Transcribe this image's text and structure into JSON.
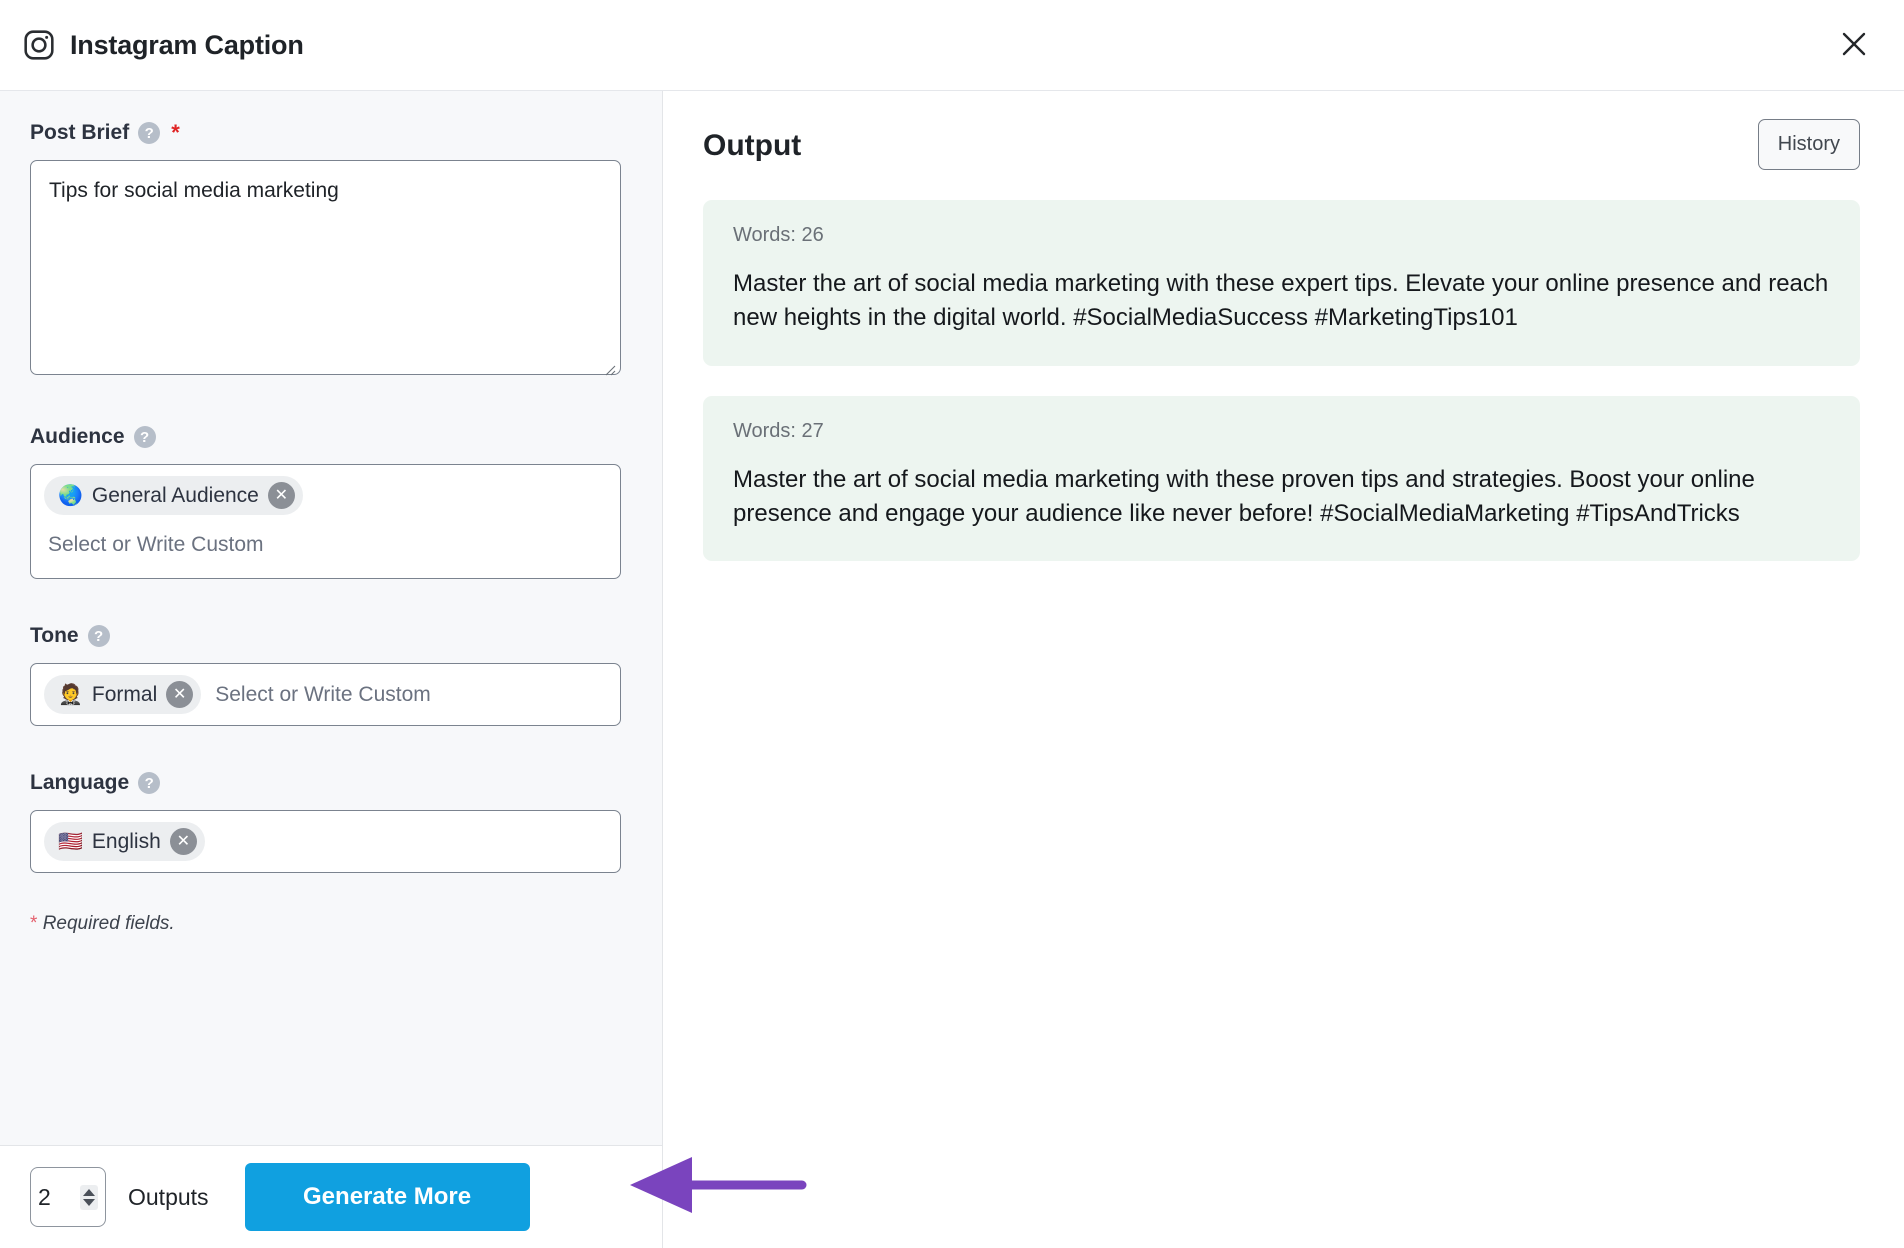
{
  "header": {
    "icon": "instagram-icon",
    "title": "Instagram Caption",
    "close_icon": "close-icon"
  },
  "form": {
    "post_brief": {
      "label": "Post Brief",
      "help_icon": "help-icon",
      "required_marker": "*",
      "value": "Tips for social media marketing"
    },
    "audience": {
      "label": "Audience",
      "help_icon": "help-icon",
      "tags": [
        {
          "emoji": "🌏",
          "label": "General Audience",
          "remove_icon": "remove-icon"
        }
      ],
      "placeholder": "Select or Write Custom"
    },
    "tone": {
      "label": "Tone",
      "help_icon": "help-icon",
      "tags": [
        {
          "emoji": "🤵",
          "label": "Formal",
          "remove_icon": "remove-icon"
        }
      ],
      "placeholder": "Select or Write Custom"
    },
    "language": {
      "label": "Language",
      "help_icon": "help-icon",
      "tags": [
        {
          "emoji": "🇺🇸",
          "label": "English",
          "remove_icon": "remove-icon"
        }
      ],
      "placeholder": ""
    },
    "required_note_star": "*",
    "required_note": "Required fields."
  },
  "actionbar": {
    "outputs_count": "2",
    "outputs_label": "Outputs",
    "generate_label": "Generate More"
  },
  "output": {
    "title": "Output",
    "history_label": "History",
    "cards": [
      {
        "words_label": "Words: 26",
        "text": "Master the art of social media marketing with these expert tips. Elevate your online presence and reach new heights in the digital world. #SocialMediaSuccess #MarketingTips101"
      },
      {
        "words_label": "Words: 27",
        "text": "Master the art of social media marketing with these proven tips and strategies. Boost your online presence and engage your audience like never before! #SocialMediaMarketing #TipsAndTricks"
      }
    ]
  },
  "annotation": {
    "arrow_color": "#7a44be",
    "points_to": "generate-more-button"
  },
  "colors": {
    "accent_button": "#10a0e0",
    "panel_bg": "#f7f8fa",
    "card_bg": "#edf5f0",
    "required_red": "#e02424",
    "arrow_purple": "#7a44be"
  }
}
